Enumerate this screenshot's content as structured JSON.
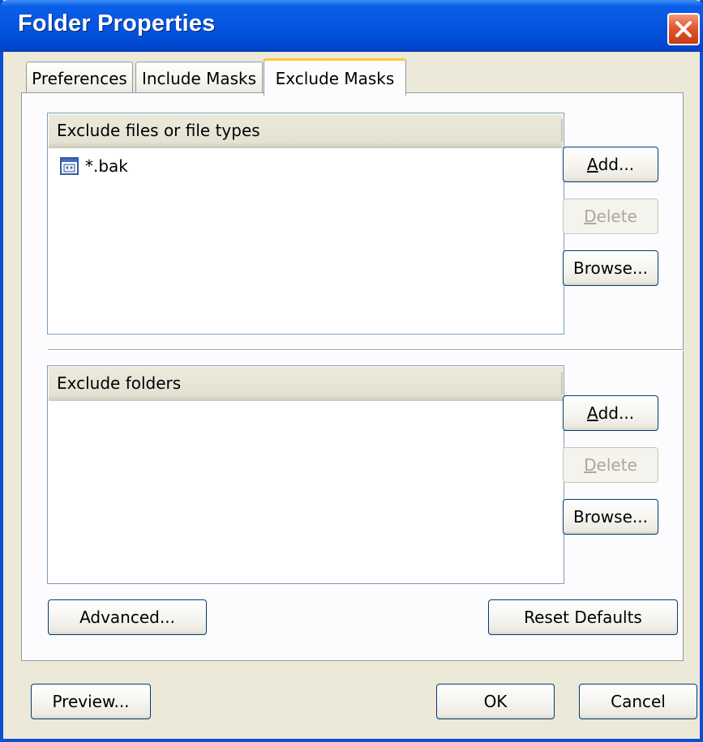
{
  "window": {
    "title": "Folder Properties"
  },
  "tabs": [
    {
      "label": "Preferences"
    },
    {
      "label": "Include Masks"
    },
    {
      "label": "Exclude Masks",
      "active": true
    }
  ],
  "files_section": {
    "header": "Exclude files or file types",
    "items": [
      "*.bak"
    ],
    "add_first": "A",
    "add_rest": "dd...",
    "delete_first": "D",
    "delete_rest": "elete",
    "browse_label": "Browse..."
  },
  "folders_section": {
    "header": "Exclude folders",
    "items": [],
    "add_first": "A",
    "add_rest": "dd...",
    "delete_first": "D",
    "delete_rest": "elete",
    "browse_label": "Browse..."
  },
  "panel_buttons": {
    "advanced": "Advanced...",
    "reset": "Reset Defaults"
  },
  "footer": {
    "preview": "Preview...",
    "ok": "OK",
    "cancel": "Cancel"
  },
  "colors": {
    "titlebar": "#0555E0",
    "face": "#ECE9D8",
    "active_tab_accent": "#FFC83C",
    "close_button": "#E2562E"
  },
  "icons": {
    "close": "close-x-icon",
    "file_item": "file-type-icon"
  }
}
